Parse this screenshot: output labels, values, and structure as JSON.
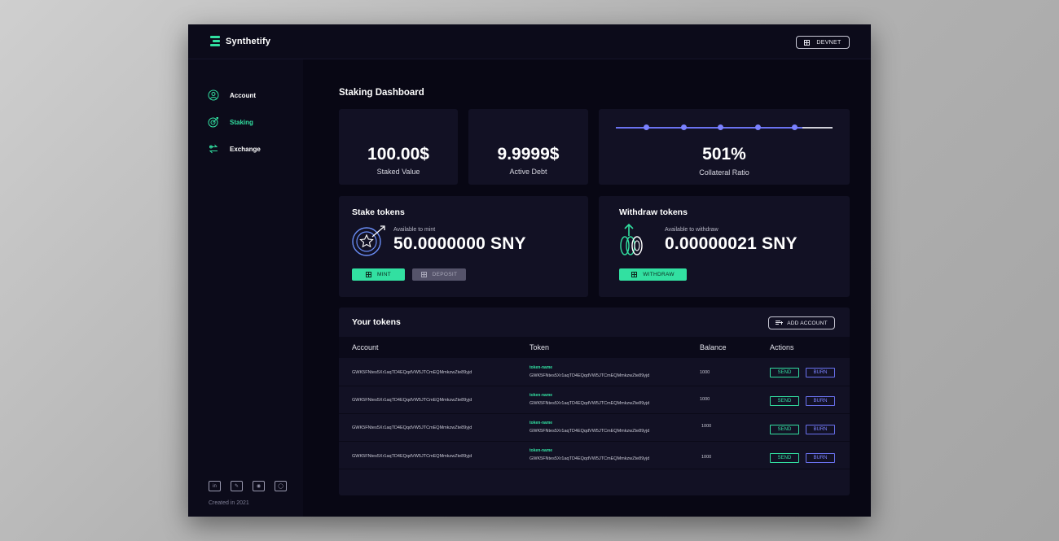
{
  "app": {
    "name": "Synthetify",
    "network": "DEVNET"
  },
  "sidebar": {
    "items": [
      {
        "label": "Account",
        "active": false
      },
      {
        "label": "Staking",
        "active": true
      },
      {
        "label": "Exchange",
        "active": false
      }
    ],
    "footer": "Created in 2021",
    "socials": [
      "linkedin-icon",
      "twitter-icon",
      "discord-icon",
      "github-icon"
    ]
  },
  "page": {
    "title": "Staking Dashboard"
  },
  "stats": {
    "staked_value": "100.00$",
    "staked_label": "Staked Value",
    "active_debt": "9.9999$",
    "debt_label": "Active Debt",
    "collateral_ratio": "501%",
    "ratio_label": "Collateral Ratio",
    "ratio_fill": 0.86
  },
  "stake": {
    "title": "Stake tokens",
    "avail_label": "Available to mint",
    "avail_value": "50.0000000 SNY",
    "mint_label": "MINT",
    "deposit_label": "DEPOSIT"
  },
  "withdraw": {
    "title": "Withdraw tokens",
    "avail_label": "Available to withdraw",
    "avail_value": "0.00000021 SNY",
    "withdraw_label": "WITHDRAW"
  },
  "tokens": {
    "title": "Your tokens",
    "add_label": "ADD ACCOUNT",
    "columns": [
      "Account",
      "Token",
      "Balance",
      "Actions"
    ],
    "send_label": "SEND",
    "burn_label": "BURN",
    "rows": [
      {
        "account": "GWK5FNtes5Xr1aqTD4EQqdVW5JTCmEQMmkzwZte89yjd",
        "token_name": "token-name",
        "token_address": "GWK5FNtes5Xr1aqTD4EQqdVW5JTCmEQMmkzwZte89yjd",
        "balance": "1000"
      },
      {
        "account": "GWK5FNtes5Xr1aqTD4EQqdVW5JTCmEQMmkzwZte89yjd",
        "token_name": "token-name",
        "token_address": "GWK5FNtes5Xr1aqTD4EQqdVW5JTCmEQMmkzwZte89yjd",
        "balance": "1000"
      },
      {
        "account": "GWK5FNtes5Xr1aqTD4EQqdVW5JTCmEQMmkzwZte89yjd",
        "token_name": "token-name",
        "token_address": "GWK5FNtes5Xr1aqTD4EQqdVW5JTCmEQMmkzwZte89yjd",
        "balance": "1000"
      },
      {
        "account": "GWK5FNtes5Xr1aqTD4EQqdVW5JTCmEQMmkzwZte89yjd",
        "token_name": "token-name",
        "token_address": "GWK5FNtes5Xr1aqTD4EQqdVW5JTCmEQMmkzwZte89yjd",
        "balance": "1000"
      }
    ]
  },
  "colors": {
    "accent": "#32e0a1",
    "secondary": "#6a72f0",
    "background": "#080714",
    "card": "#121124"
  }
}
